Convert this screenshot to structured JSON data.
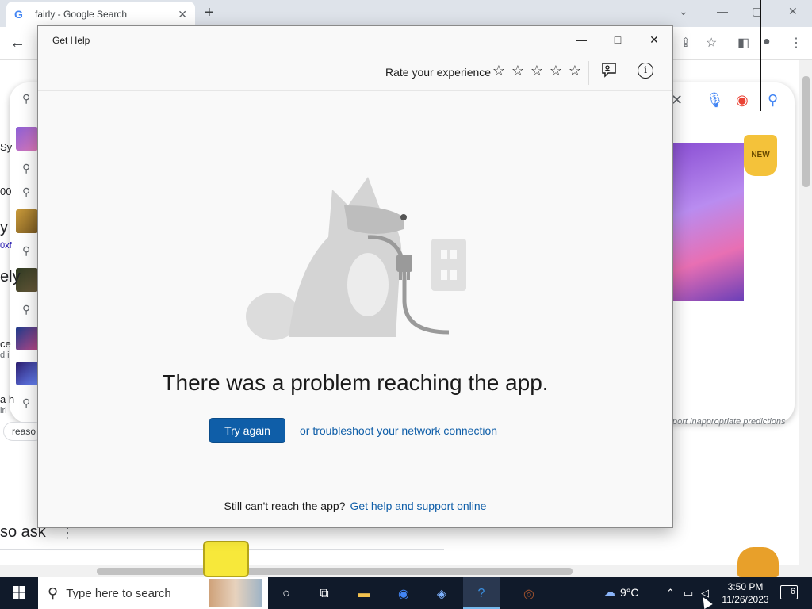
{
  "browser": {
    "tab_title": "fairly - Google Search",
    "tab_favicon": "G",
    "report_text": "port inappropriate predictions",
    "reason_chip": "reaso",
    "people_ask": "so ask",
    "left_fragments": [
      "Sy",
      "00",
      "y",
      "0xf",
      "ely",
      "ce",
      "d i",
      "a h",
      "irl"
    ]
  },
  "get_help": {
    "window_title": "Get Help",
    "rate_label": "Rate your experience",
    "stars": [
      "☆",
      "☆",
      "☆",
      "☆",
      "☆"
    ],
    "heading": "There was a problem reaching the app.",
    "try_again_label": "Try again",
    "troubleshoot_link": "or troubleshoot your network connection",
    "still_text": "Still can't reach the app?",
    "help_link": "Get help and support online"
  },
  "decor": {
    "bag_label": "NEW"
  },
  "taskbar": {
    "search_placeholder": "Type here to search",
    "weather_temp": "9°C",
    "time": "3:50 PM",
    "date": "11/26/2023",
    "notification_count": "6"
  },
  "colors": {
    "accent": "#0f5ea8",
    "taskbar_bg": "#101a2a"
  }
}
